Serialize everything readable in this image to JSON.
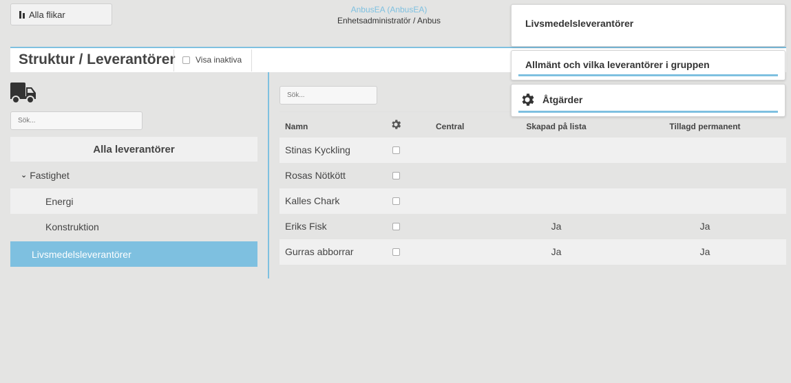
{
  "topbar": {
    "tabs_button_label": "Alla flikar",
    "user_name": "AnbusEA (AnbusEA)",
    "user_role": "Enhetsadministratör / Anbus"
  },
  "header": {
    "title": "Struktur / Leverantörer",
    "show_inactive_label": "Visa inaktiva"
  },
  "left": {
    "search_placeholder": "Sök...",
    "all_suppliers": "Alla leverantörer",
    "tree": {
      "fastighet": "Fastighet",
      "energi": "Energi",
      "konstruktion": "Konstruktion",
      "livsmedel": "Livsmedelsleverantörer"
    }
  },
  "table": {
    "search_placeholder": "Sök...",
    "headers": {
      "name": "Namn",
      "central": "Central",
      "created_on_list": "Skapad på lista",
      "added_permanent": "Tillagd permanent"
    },
    "rows": [
      {
        "name": "Stinas Kyckling",
        "central": "",
        "created": "",
        "permanent": ""
      },
      {
        "name": "Rosas Nötkött",
        "central": "",
        "created": "",
        "permanent": ""
      },
      {
        "name": "Kalles Chark",
        "central": "",
        "created": "",
        "permanent": ""
      },
      {
        "name": "Eriks Fisk",
        "central": "",
        "created": "Ja",
        "permanent": "Ja"
      },
      {
        "name": "Gurras abborrar",
        "central": "",
        "created": "Ja",
        "permanent": "Ja"
      }
    ]
  },
  "panels": {
    "group_name": "Livsmedelsleverantörer",
    "general": "Allmänt och vilka leverantörer i gruppen",
    "actions": "Åtgärder"
  },
  "colors": {
    "accent": "#7ec0e0",
    "background": "#e4e4e3"
  }
}
